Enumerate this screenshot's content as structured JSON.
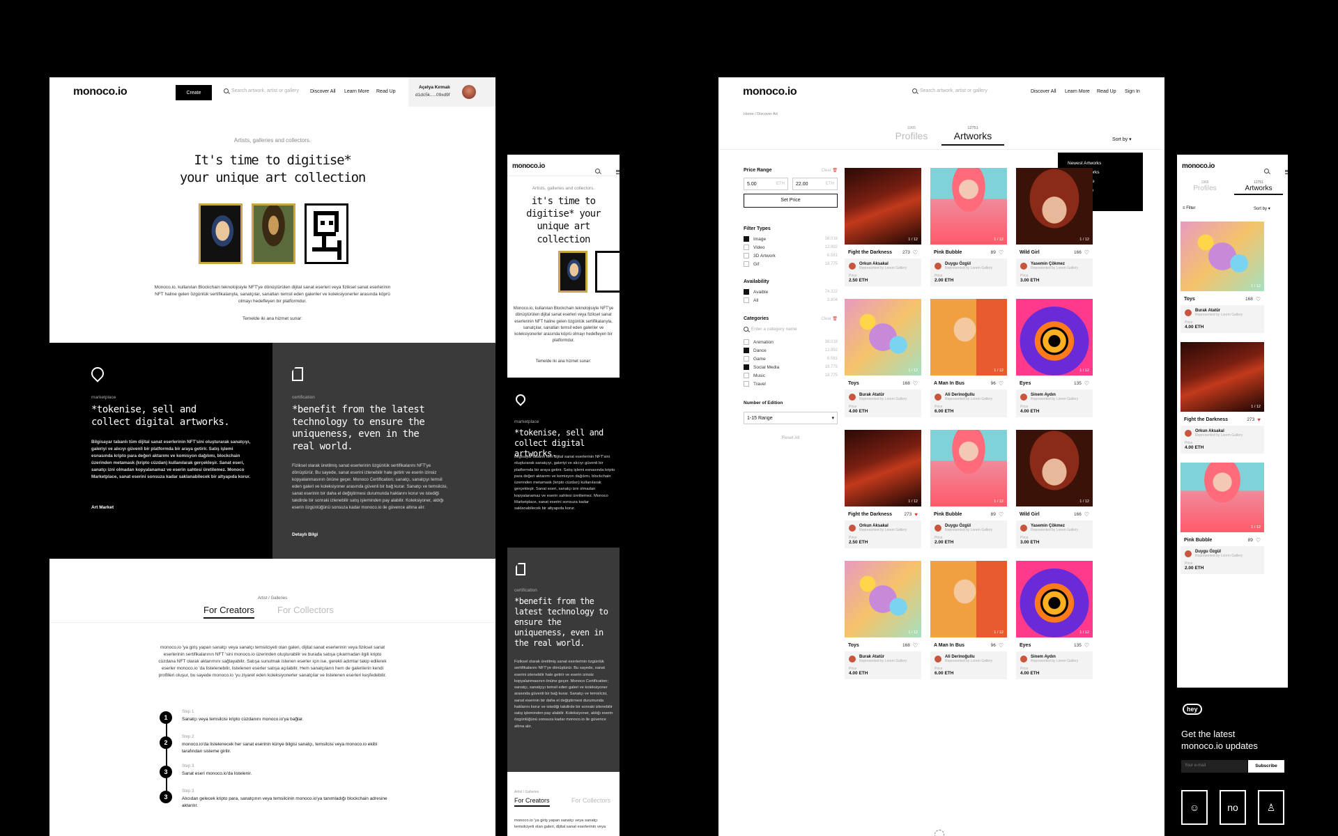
{
  "brand": {
    "logo": "monoco.io"
  },
  "desktop_home": {
    "nav": {
      "create": "Create",
      "search_placeholder": "Search artwork, artist or gallery",
      "links": [
        "Discover All",
        "Learn More",
        "Read Up"
      ],
      "user_name": "Açelya Kırmalı",
      "wallet": "d1dc5k.....09xd9f"
    },
    "hero": {
      "kicker": "Artists, galleries and collectors.",
      "title_line1": "It's time to digitise*",
      "title_line2": "your unique art collection",
      "description": "Monoco.io, kullanılan Blockchain teknolojisiyle NFT'ye dönüştürülen dijital sanat eserleri veya fiziksel sanat eserlerinin NFT haline gelen özgünlük sertifikalarıyla, sanatçılar, sanatları temsil eden galeriler ve koleksiyonerler arasında köprü olmayı hedefleyen bir platformdur.",
      "services": "Temelde iki ana hizmet sunar:"
    },
    "features": [
      {
        "label": "marketplace",
        "title": "*tokenise, sell and collect digital artworks.",
        "text": "Bilgisayar tabanlı tüm dijital sanat eserlerinin NFT'sini oluşturarak sanatçıyı, galeriyi ve alıcıyı güvenli bir platformda bir araya getirir. Satış işlemi esnasında kripto para değeri aktarımı ve komisyon dağılımı, blockchain üzerinden metamask (kripto cüzdan) kullanılarak gerçekleşir. Sanat eseri, sanatçı izni olmadan kopyalanamaz ve eserin sahtesi üretilemez. Monoco Marketplace, sanat eserini sonsuza kadar saklanabilecek bir altyapıda korur.",
        "link": "Art Market"
      },
      {
        "label": "certification",
        "title": "*benefit from the latest technology to ensure the uniqueness, even in the real world.",
        "text": "Fiziksel olarak üretilmiş sanat eserlerinin özgünlük sertifikalarını NFT'ye dönüştürür. Bu sayede, sanat eserini izlenebilir hale getirir ve eserin izinsiz kopyalanmasının önüne geçer. Monoco Certification; sanatçı, sanatçıyı temsil eden galeri ve koleksiyoner arasında güvenli bir bağ kurar. Sanatçı ve temsilcisi, sanat eserinin bir daha el değiştirmesi durumunda haklarını korur ve istediği takdirde bir sonraki izlenebilir satış işleminden pay alabilir. Koleksiyoner, aldığı eserin özgünlüğünü sonsuza kadar monoco.io ile güvence altına alır.",
        "link": "Detaylı Bilgi"
      }
    ],
    "creators": {
      "kicker": "Artist / Galleries",
      "tabs": [
        "For Creators",
        "For Collectors"
      ],
      "text": "monoco.io 'ya giriş yapan sanatçı veya sanatçı temsilciyeti olan galeri, dijital sanat eserlerinin veya fiziksel sanat eserlerinin sertifikalarının NFT 'sini monoco.io üzerinden oluşturabilir ve burada satışa çıkarmadan ilgili kripto cüzdana NFT olarak aktarımını sağlayabilir. Satışa sunulmak istenen eserler için ise, gerekli adımlar takip edilerek eserler monoco.io 'da listelenebilir, listelenen eserler satışa açılabilir. Hem sanatçıların hem de galerilerin kendi profilleri oluşur, bu sayede monoco.io 'yu ziyaret eden koleksiyonerler sanatçılar ve listelenen eserleri keşfedebilir.",
      "steps": [
        {
          "label": "Step 1",
          "num": "1",
          "text": "Sanatçı veya temsilcisi kripto cüzdanını monoco.io'ya bağlar."
        },
        {
          "label": "Step 2",
          "num": "2",
          "text": "monoco.io'da listelenecek her sanat eserinin künye bilgisi sanatçı, temsilcisi veya monoco.io ekibi tarafından sisteme girilir."
        },
        {
          "label": "Step 3",
          "num": "3",
          "text": "Sanat eseri monoco.io'da listelenir."
        },
        {
          "label": "Step 3",
          "num": "3",
          "text": "Alıcıdan gelecek kripto para, sanatçının veya temsilcinin monoco.io'ya tanımladığı blockchain adresine aktarılır."
        }
      ]
    }
  },
  "mobile_home": {
    "kicker": "Artists, galleries and collectors.",
    "title": "it's time to digitise* your unique art collection",
    "description": "Monoco.io, kullanılan Blockchain teknolojisiyle NFT'ye dönüştürülen dijital sanat eserleri veya fiziksel sanat eserlerinin NFT haline gelen özgünlük sertifikalarıyla, sanatçılar, sanatları temsil eden galeriler ve koleksiyonerler arasında köprü olmayı hedefleyen bir platformdur.",
    "services": "Temelde iki ana hizmet sunar:",
    "f1_label": "marketplace",
    "f1_title": "*tokenise, sell and collect digital artworks.",
    "f1_text": "Bilgisayar tabanlı tüm dijital sanat eserlerinin NFT'sini oluşturarak sanatçıyı, galeriyi ve alıcıyı güvenli bir platformda bir araya getirir. Satış işlemi esnasında kripto para değeri aktarımı ve komisyon dağılımı, blockchain üzerinden metamask (kripto cüzdan) kullanılarak gerçekleşir. Sanat eseri, sanatçı izni olmadan kopyalanamaz ve eserin sahtesi üretilemez. Monoco Marketplace, sanat eserini sonsuza kadar saklanabilecek bir altyapıda korur.",
    "f2_label": "certification",
    "f2_title": "*benefit from the latest technology to ensure the uniqueness, even in the real world.",
    "f2_text": "Fiziksel olarak üretilmiş sanat eserlerinin özgünlük sertifikalarını NFT'ye dönüştürür. Bu sayede, sanat eserini izlenebilir hale getirir ve eserin izinsiz kopyalanmasının önüne geçer. Monoco Certification; sanatçı, sanatçıyı temsil eden galeri ve koleksiyoner arasında güvenli bir bağ kurar. Sanatçı ve temsilcisi, sanat eserinin bir daha el değiştirmesi durumunda haklarını korur ve istediği takdirde bir sonraki izlenebilir satış işleminden pay alabilir. Koleksiyoner, aldığı eserin özgünlüğünü sonsuza kadar monoco.io ile güvence altına alır.",
    "creators_kicker": "Artist / Galleries",
    "tabs": [
      "For Creators",
      "For Collectors"
    ],
    "creators_text": "monoco.io 'ya giriş yapan sanatçı veya sanatçı temsilciyeti olan galeri, dijital sanat eserlerinin veya"
  },
  "discover": {
    "nav": {
      "search_placeholder": "Search artwork, artist or gallery",
      "links": [
        "Discover All",
        "Learn More",
        "Read Up",
        "Sign In"
      ]
    },
    "breadcrumb": "Home / Discover Art",
    "tabs": [
      {
        "count": "1965",
        "label": "Profiles"
      },
      {
        "count": "12751",
        "label": "Artworks"
      }
    ],
    "sort_label": "Sort by",
    "sort_options": [
      "Newest Artworks",
      "Oldest Artworks",
      "Highest Price",
      "Lowest Price"
    ],
    "filters": {
      "price_title": "Price Range",
      "clear": "Clear",
      "min": "5.00",
      "max": "22.00",
      "unit": "ETH",
      "set_price": "Set Price",
      "types_title": "Filter Types",
      "types": [
        {
          "name": "Image",
          "count": "38.018",
          "on": true
        },
        {
          "name": "Video",
          "count": "12.992",
          "on": false
        },
        {
          "name": "3D Artwork",
          "count": "6.581",
          "on": false
        },
        {
          "name": "Gif",
          "count": "18.775",
          "on": false
        }
      ],
      "avail_title": "Availability",
      "avail": [
        {
          "name": "Avaible",
          "count": "74.322",
          "on": true
        },
        {
          "name": "All",
          "count": "3.804",
          "on": false
        }
      ],
      "cat_title": "Categories",
      "cat_search": "Enter a category name",
      "cats": [
        {
          "name": "Animation",
          "count": "38.018",
          "on": false
        },
        {
          "name": "Dance",
          "count": "12.992",
          "on": true
        },
        {
          "name": "Game",
          "count": "6.581",
          "on": false
        },
        {
          "name": "Social Media",
          "count": "18.775",
          "on": true
        },
        {
          "name": "Music",
          "count": "18.775",
          "on": false
        },
        {
          "name": "Travel",
          "count": "",
          "on": false
        }
      ],
      "edition_title": "Number of Edition",
      "edition_value": "1-15 Range",
      "reset": "Reset All"
    },
    "card_common": {
      "represented": "Represented by Lorem Gallery",
      "price_label": "Price",
      "edition": "1 / 12"
    },
    "cards": [
      {
        "title": "Fight the Darkness",
        "likes": "273",
        "owner": "Orkun Aksakal",
        "price": "2.50 ETH",
        "art": "venom",
        "liked": false
      },
      {
        "title": "Pink Bubble",
        "likes": "89",
        "owner": "Duygu Özgül",
        "price": "2.00 ETH",
        "art": "pink",
        "liked": false
      },
      {
        "title": "Wild Girl",
        "likes": "166",
        "owner": "Yasemin Çökmez",
        "price": "3.00 ETH",
        "art": "girl",
        "liked": false
      },
      {
        "title": "Toys",
        "likes": "168",
        "owner": "Burak Atatür",
        "price": "4.00 ETH",
        "art": "toys",
        "liked": false
      },
      {
        "title": "A Man In Bus",
        "likes": "96",
        "owner": "Ali Derinoğullu",
        "price": "6.00 ETH",
        "art": "man",
        "liked": false
      },
      {
        "title": "Eyes",
        "likes": "135",
        "owner": "Sinem Aydın",
        "price": "4.00 ETH",
        "art": "eyes",
        "liked": false
      },
      {
        "title": "Fight the Darkness",
        "likes": "273",
        "owner": "Orkun Aksakal",
        "price": "2.50 ETH",
        "art": "venom",
        "liked": true
      },
      {
        "title": "Pink Bubble",
        "likes": "89",
        "owner": "Duygu Özgül",
        "price": "2.00 ETH",
        "art": "pink",
        "liked": false
      },
      {
        "title": "Wild Girl",
        "likes": "166",
        "owner": "Yasemin Çökmez",
        "price": "3.00 ETH",
        "art": "girl",
        "liked": false
      },
      {
        "title": "Toys",
        "likes": "168",
        "owner": "Burak Atatür",
        "price": "4.00 ETH",
        "art": "toys",
        "liked": false
      },
      {
        "title": "A Man In Bus",
        "likes": "96",
        "owner": "Ali Derinoğullu",
        "price": "6.00 ETH",
        "art": "man",
        "liked": false
      },
      {
        "title": "Eyes",
        "likes": "135",
        "owner": "Sinem Aydın",
        "price": "4.00 ETH",
        "art": "eyes",
        "liked": false
      }
    ]
  },
  "mobile_discover": {
    "tabs": [
      {
        "count": "1965",
        "label": "Profiles"
      },
      {
        "count": "12751",
        "label": "Artworks"
      }
    ],
    "filter": "Filter",
    "sort": "Sort by",
    "cards": [
      {
        "title": "Toys",
        "likes": "168",
        "owner": "Burak Atatür",
        "price": "4.00 ETH",
        "art": "toys",
        "liked": false
      },
      {
        "title": "Fight the Darkness",
        "likes": "273",
        "owner": "Orkun Aksakal",
        "price": "4.00 ETH",
        "art": "venom",
        "liked": true
      },
      {
        "title": "Pink Bubble",
        "likes": "89",
        "owner": "Duygu Özgül",
        "price": "2.00 ETH",
        "art": "pink",
        "liked": false
      }
    ]
  },
  "newsletter": {
    "badge": "hey",
    "title": "Get the latest monoco.io updates",
    "placeholder": "Your e-mail",
    "button": "Subscribe",
    "icon_text": "no"
  },
  "colors": {
    "venom": "#7a1f12",
    "pink": "#f08a9a",
    "girl": "#8a2a18",
    "toys": "#e89ac0",
    "man": "#f0a040",
    "eyes": "#6a2ad8",
    "like": "#e03a3a"
  }
}
